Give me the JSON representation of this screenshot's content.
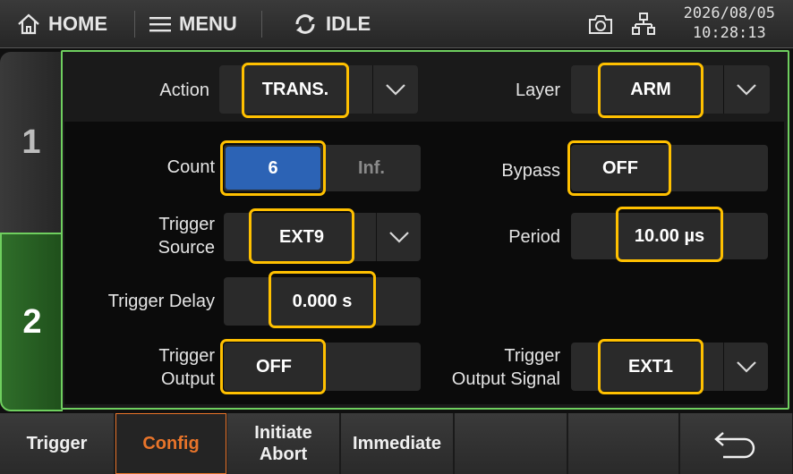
{
  "topbar": {
    "home_label": "HOME",
    "menu_label": "MENU",
    "status_label": "IDLE",
    "date": "2026/08/05",
    "time": "10:28:13"
  },
  "side_tabs": [
    {
      "label": "1"
    },
    {
      "label": "2"
    }
  ],
  "top_row": {
    "action_label": "Action",
    "action_value": "TRANS.",
    "layer_label": "Layer",
    "layer_value": "ARM"
  },
  "fields": {
    "count_label": "Count",
    "count_value": "6",
    "count_inf": "Inf.",
    "bypass_label": "Bypass",
    "bypass_value": "OFF",
    "trigger_source_label_1": "Trigger",
    "trigger_source_label_2": "Source",
    "trigger_source_value": "EXT9",
    "period_label": "Period",
    "period_value": "10.00 µs",
    "trigger_delay_label": "Trigger Delay",
    "trigger_delay_value": "0.000 s",
    "trigger_output_label_1": "Trigger",
    "trigger_output_label_2": "Output",
    "trigger_output_value": "OFF",
    "trigger_output_signal_label_1": "Trigger",
    "trigger_output_signal_label_2": "Output Signal",
    "trigger_output_signal_value": "EXT1"
  },
  "softkeys": {
    "trigger": "Trigger",
    "config": "Config",
    "initiate_line1": "Initiate",
    "initiate_line2": "Abort",
    "immediate": "Immediate"
  },
  "colors": {
    "highlight": "#ffc000",
    "active_tab": "#6fcf5f",
    "selected_field": "#2c63b5",
    "active_softkey": "#e8742a"
  },
  "icons": [
    "home-icon",
    "menu-icon",
    "idle-sync-icon",
    "camera-icon",
    "network-icon",
    "chevron-down-icon",
    "back-arrow-icon"
  ]
}
